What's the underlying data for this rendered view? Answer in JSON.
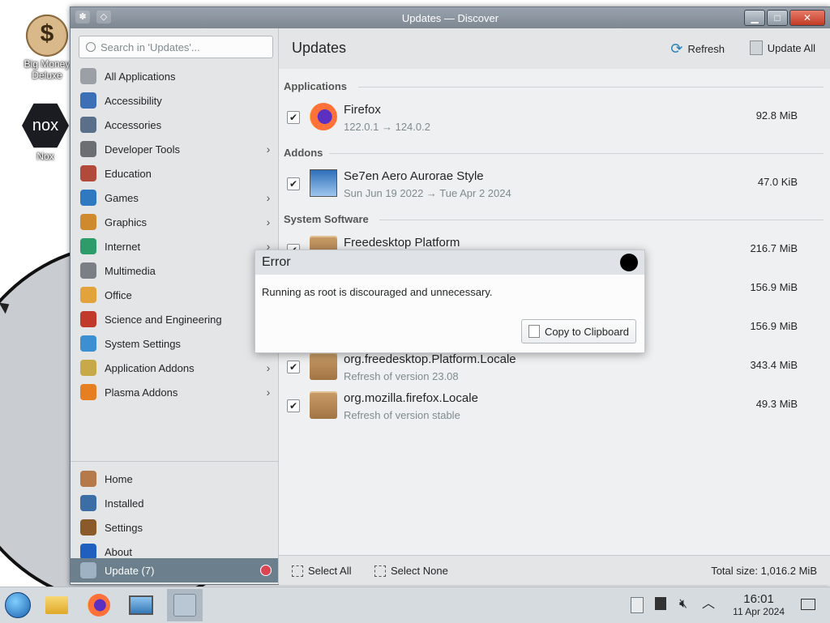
{
  "desktop": {
    "icons": [
      {
        "label": "Big Money Deluxe",
        "glyph": "$"
      },
      {
        "label": "Nox",
        "glyph": "nox"
      }
    ]
  },
  "window": {
    "title": "Updates — Discover",
    "search_placeholder": "Search in 'Updates'...",
    "categories": [
      {
        "label": "All Applications",
        "icon": "grid-icon",
        "color": "#9aa0a6",
        "chevron": false
      },
      {
        "label": "Accessibility",
        "icon": "accessibility-icon",
        "color": "#3b6fb6",
        "chevron": false
      },
      {
        "label": "Accessories",
        "icon": "accessories-icon",
        "color": "#5a6f8a",
        "chevron": false
      },
      {
        "label": "Developer Tools",
        "icon": "developer-tools-icon",
        "color": "#6b6f74",
        "chevron": true
      },
      {
        "label": "Education",
        "icon": "education-icon",
        "color": "#b24a3b",
        "chevron": false
      },
      {
        "label": "Games",
        "icon": "games-icon",
        "color": "#2f79c0",
        "chevron": true
      },
      {
        "label": "Graphics",
        "icon": "graphics-icon",
        "color": "#d08a2e",
        "chevron": true
      },
      {
        "label": "Internet",
        "icon": "internet-icon",
        "color": "#2e9c6a",
        "chevron": true
      },
      {
        "label": "Multimedia",
        "icon": "multimedia-icon",
        "color": "#7a7f85",
        "chevron": false
      },
      {
        "label": "Office",
        "icon": "office-icon",
        "color": "#e2a33a",
        "chevron": false
      },
      {
        "label": "Science and Engineering",
        "icon": "science-icon",
        "color": "#c0392b",
        "chevron": false
      },
      {
        "label": "System Settings",
        "icon": "system-settings-icon",
        "color": "#3c8fd1",
        "chevron": false
      },
      {
        "label": "Application Addons",
        "icon": "application-addons-icon",
        "color": "#c7a94a",
        "chevron": true
      },
      {
        "label": "Plasma Addons",
        "icon": "plasma-addons-icon",
        "color": "#e67e22",
        "chevron": true
      }
    ],
    "nav": [
      {
        "label": "Home",
        "icon": "home-icon",
        "color": "#b5794a"
      },
      {
        "label": "Installed",
        "icon": "installed-icon",
        "color": "#3a6ea5"
      },
      {
        "label": "Settings",
        "icon": "settings-icon",
        "color": "#8a5a2b"
      },
      {
        "label": "About",
        "icon": "about-icon",
        "color": "#1e5fbf"
      }
    ],
    "update_nav": {
      "label": "Update (7)"
    },
    "main": {
      "title": "Updates",
      "refresh_label": "Refresh",
      "update_all_label": "Update All",
      "sections": {
        "applications": "Applications",
        "addons": "Addons",
        "system": "System Software"
      },
      "rows": [
        {
          "name": "Firefox",
          "sub": "122.0.1 → 124.0.2",
          "size": "92.8 MiB",
          "icon": "firefox-icon"
        },
        {
          "name": "Se7en Aero Aurorae Style",
          "sub": "Sun Jun 19 2022 → Tue Apr 2 2024",
          "size": "47.0 KiB",
          "icon": "theme-icon"
        },
        {
          "name": "Freedesktop Platform",
          "sub": "",
          "size": "216.7 MiB",
          "icon": "package-icon"
        },
        {
          "name": "",
          "sub": "",
          "size": "156.9 MiB",
          "icon": "package-icon"
        },
        {
          "name": "",
          "sub": "",
          "size": "156.9 MiB",
          "icon": "package-icon"
        },
        {
          "name": "org.freedesktop.Platform.Locale",
          "sub": "Refresh of version 23.08",
          "size": "343.4 MiB",
          "icon": "package-icon"
        },
        {
          "name": "org.mozilla.firefox.Locale",
          "sub": "Refresh of version stable",
          "size": "49.3 MiB",
          "icon": "package-icon"
        }
      ],
      "footer": {
        "select_all": "Select All",
        "select_none": "Select None",
        "total": "Total size: 1,016.2 MiB"
      }
    }
  },
  "dialog": {
    "title": "Error",
    "message": "Running as root is discouraged and unnecessary.",
    "copy_label": "Copy to Clipboard"
  },
  "taskbar": {
    "time": "16:01",
    "date": "11 Apr 2024"
  }
}
